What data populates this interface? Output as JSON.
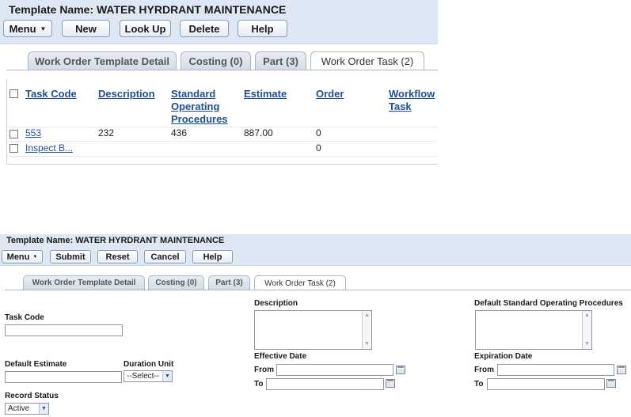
{
  "top": {
    "template_title": "Template Name: WATER HYRDRANT MAINTENANCE",
    "toolbar": {
      "menu": "Menu",
      "new": "New",
      "lookup": "Look Up",
      "delete": "Delete",
      "help": "Help"
    },
    "tabs": [
      "Work Order Template Detail",
      "Costing (0)",
      "Part (3)",
      "Work Order Task (2)"
    ],
    "columns": [
      "Task Code",
      "Description",
      "Standard Operating Procedures",
      "Estimate",
      "Order",
      "Workflow Task"
    ],
    "rows": [
      {
        "task_code": "553",
        "description": "232",
        "sop": "436",
        "estimate": "887.00",
        "order": "0"
      },
      {
        "task_code": "Inspect B...",
        "description": "",
        "sop": "",
        "estimate": "",
        "order": "0"
      }
    ]
  },
  "bottom": {
    "template_title": "Template Name: WATER HYRDRANT MAINTENANCE",
    "toolbar": {
      "menu": "Menu",
      "submit": "Submit",
      "reset": "Reset",
      "cancel": "Cancel",
      "help": "Help"
    },
    "tabs": [
      "Work Order Template Detail",
      "Costing (0)",
      "Part (3)",
      "Work Order Task (2)"
    ],
    "form": {
      "task_code_label": "Task Code",
      "task_code_value": "",
      "description_label": "Description",
      "default_sop_label": "Default Standard Operating Procedures",
      "default_estimate_label": "Default Estimate",
      "duration_unit_label": "Duration Unit",
      "duration_unit_value": "--Select--",
      "effective_date_label": "Effective Date",
      "expiration_date_label": "Expiration Date",
      "from_label": "From",
      "to_label": "To",
      "record_status_label": "Record Status",
      "record_status_value": "Active"
    }
  }
}
